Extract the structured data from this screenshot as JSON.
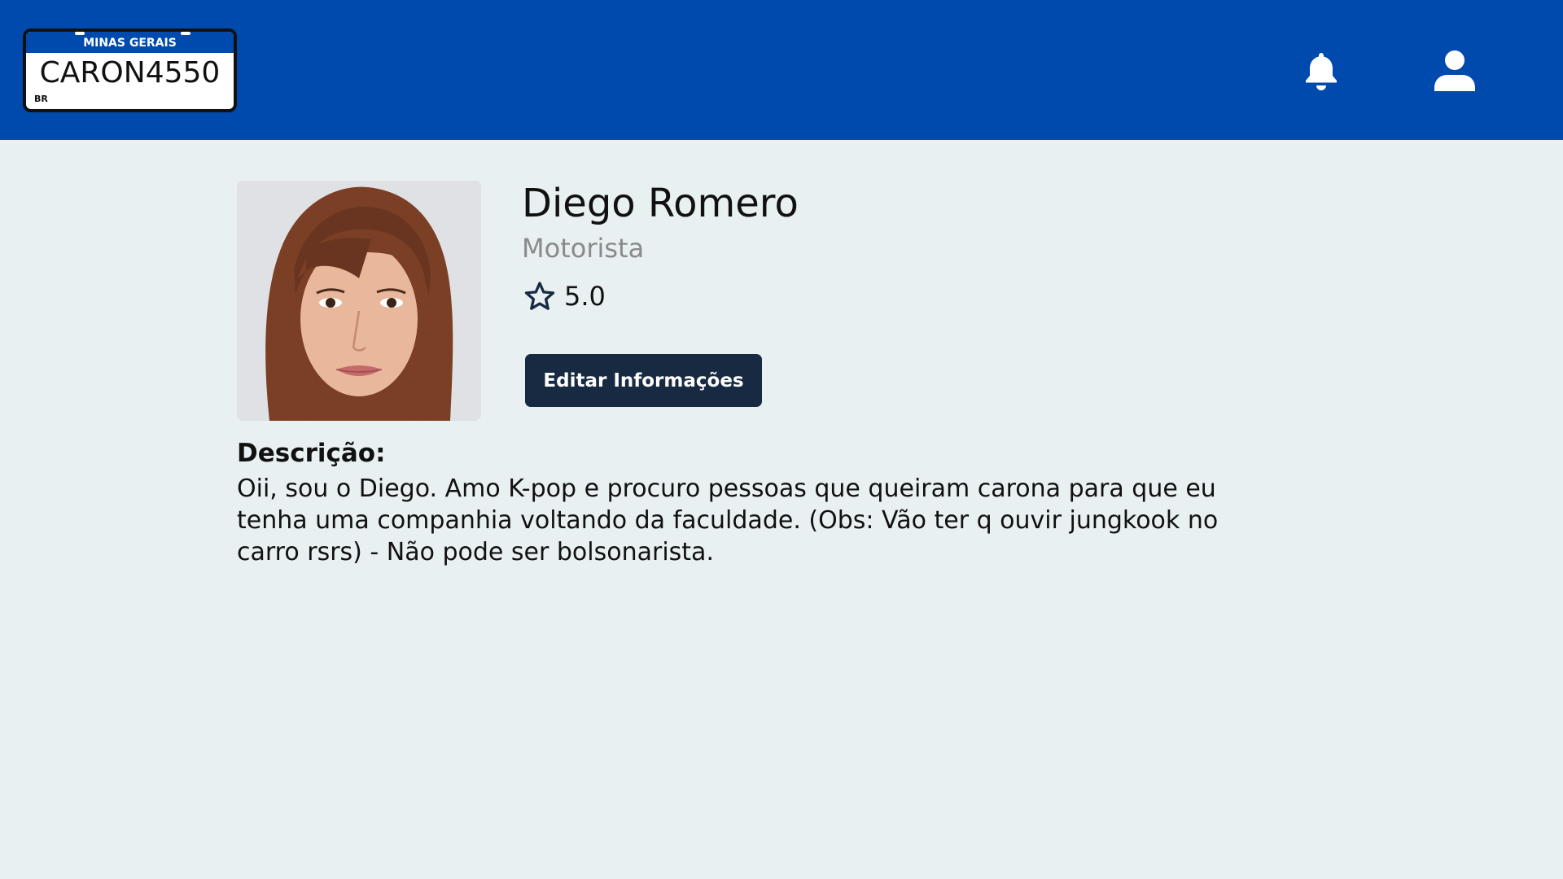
{
  "header": {
    "plate": {
      "state": "MINAS GERAIS",
      "number": "CARON4550",
      "country": "BR"
    },
    "icons": {
      "notifications": "bell-icon",
      "profile": "user-icon"
    }
  },
  "profile": {
    "name": "Diego Romero",
    "role": "Motorista",
    "rating": "5.0",
    "rating_icon": "star-outline-icon",
    "edit_button": "Editar Informações",
    "description_label": "Descrição:",
    "description": "Oii, sou o Diego. Amo K-pop e procuro pessoas que queiram carona para que eu tenha uma companhia voltando da faculdade. (Obs: Vão ter q ouvir jungkook no carro rsrs) - Não pode ser bolsonarista."
  },
  "colors": {
    "header_bg": "#004aad",
    "page_bg": "#e8f0f2",
    "button_bg": "#172a42",
    "role_text": "#8a8a8a"
  }
}
